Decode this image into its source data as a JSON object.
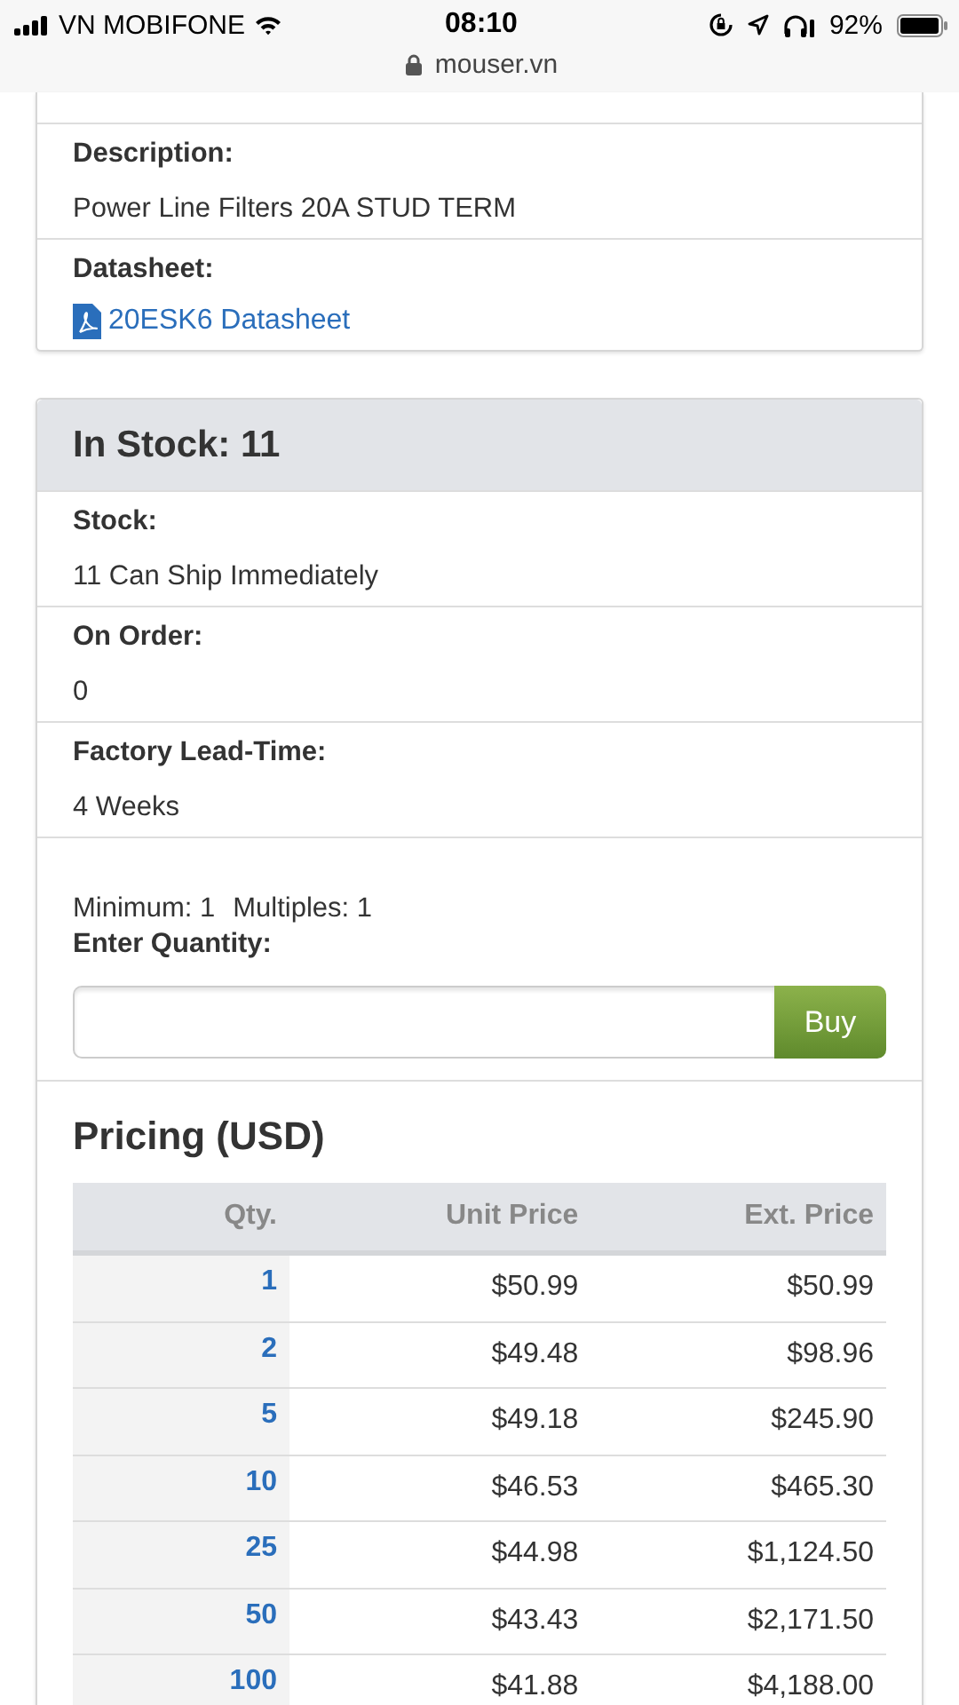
{
  "status_bar": {
    "carrier": "VN MOBIFONE",
    "time": "08:10",
    "battery": "92%",
    "url": "mouser.vn"
  },
  "details": [
    {
      "label": "Description:",
      "value": "Power Line Filters 20A STUD TERM",
      "kind": "text"
    },
    {
      "label": "Datasheet:",
      "value": "20ESK6 Datasheet",
      "kind": "link"
    }
  ],
  "stock": {
    "title": "In Stock: 11",
    "rows": [
      {
        "label": "Stock:",
        "value": "11 Can Ship Immediately"
      },
      {
        "label": "On Order:",
        "value": "0"
      },
      {
        "label": "Factory Lead-Time:",
        "value": "4 Weeks"
      }
    ],
    "minimum": "Minimum: 1",
    "multiples": "Multiples: 1",
    "quantity_label": "Enter Quantity:",
    "buy_button": "Buy"
  },
  "pricing": {
    "title": "Pricing (USD)",
    "columns": [
      "Qty.",
      "Unit Price",
      "Ext. Price"
    ],
    "rows": [
      [
        "1",
        "$50.99",
        "$50.99"
      ],
      [
        "2",
        "$49.48",
        "$98.96"
      ],
      [
        "5",
        "$49.18",
        "$245.90"
      ],
      [
        "10",
        "$46.53",
        "$465.30"
      ],
      [
        "25",
        "$44.98",
        "$1,124.50"
      ],
      [
        "50",
        "$43.43",
        "$2,171.50"
      ],
      [
        "100",
        "$41.88",
        "$4,188.00"
      ]
    ]
  }
}
